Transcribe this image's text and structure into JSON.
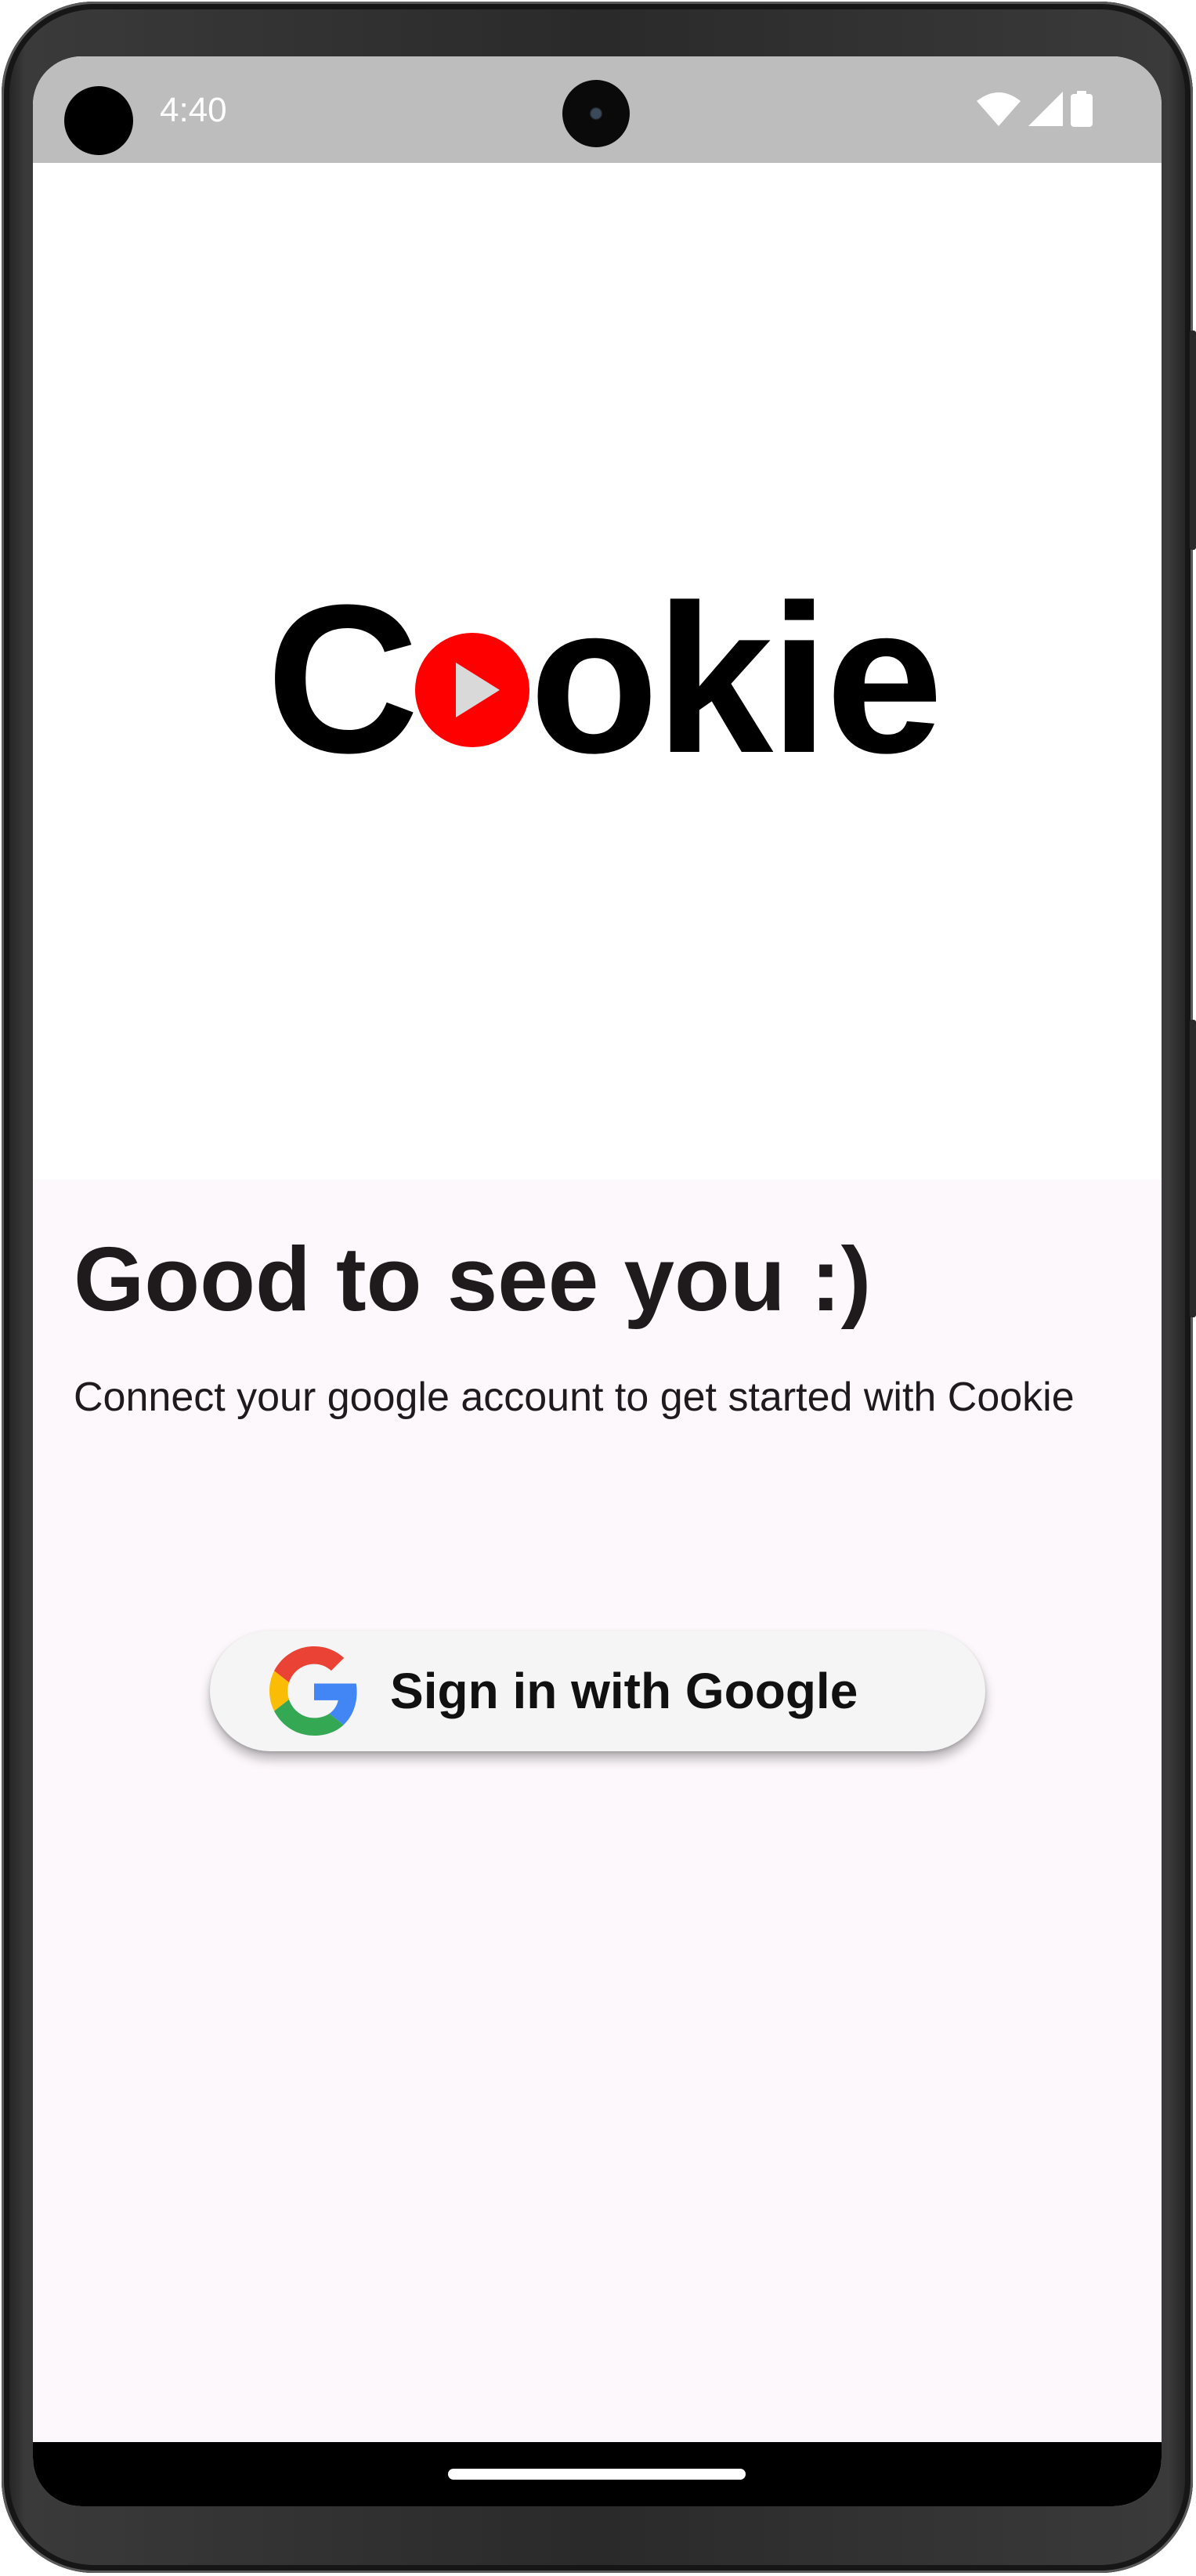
{
  "status_bar": {
    "time": "4:40",
    "icons": [
      "wifi-icon",
      "cellular-signal-icon",
      "battery-icon"
    ]
  },
  "logo": {
    "text_prefix": "C",
    "text_suffix": "okie",
    "accent_color": "#ff0000"
  },
  "welcome": {
    "headline": "Good to see you :)",
    "subtitle": "Connect your google account to get started with Cookie"
  },
  "sign_in": {
    "label": "Sign in with Google",
    "icon": "google-g-icon"
  },
  "colors": {
    "status_bar": "#bdbdbd",
    "bottom_background": "#fdf8fc",
    "button_background": "#f5f5f5",
    "text": "#1f1a1c"
  }
}
